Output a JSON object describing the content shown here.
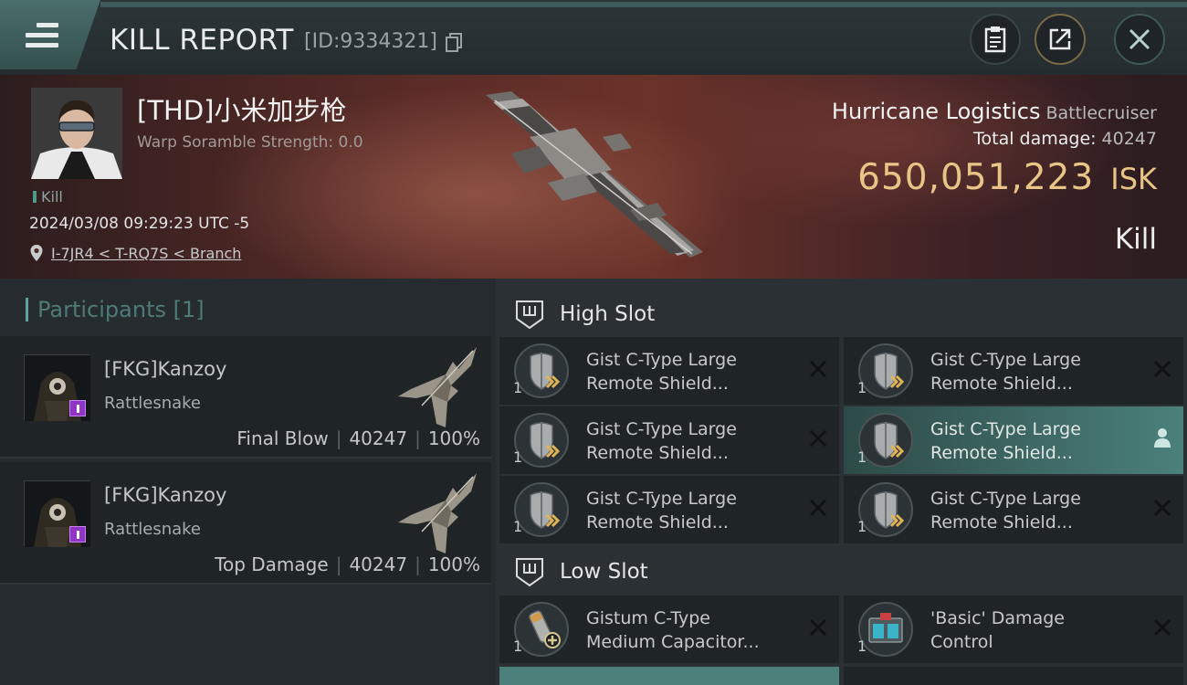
{
  "header": {
    "title": "KILL REPORT",
    "report_id": "[ID:9334321]",
    "menu_icon": "hamburger-menu-icon",
    "copy_icon": "copy-icon",
    "buttons": [
      {
        "name": "clipboard-button",
        "icon": "clipboard-icon"
      },
      {
        "name": "share-button",
        "icon": "share-icon"
      },
      {
        "name": "close-button",
        "icon": "close-icon"
      }
    ]
  },
  "victim": {
    "name": "[THD]小米加步枪",
    "scramble_label": "Warp Soramble Strength: 0.0",
    "kill_tag": "Kill",
    "timestamp": "2024/03/08 09:29:23 UTC -5",
    "location": "I-7JR4 < T-RQ7S < Branch"
  },
  "ship": {
    "name": "Hurricane Logistics",
    "class": "Battlecruiser",
    "total_damage_label": "Total damage:",
    "total_damage": "40247",
    "isk_value": "650,051,223",
    "isk_unit": "ISK",
    "result": "Kill"
  },
  "participants": {
    "title": "Participants [1]",
    "rows": [
      {
        "name": "[FKG]Kanzoy",
        "ship": "Rattlesnake",
        "role": "Final Blow",
        "damage": "40247",
        "percent": "100%"
      },
      {
        "name": "[FKG]Kanzoy",
        "ship": "Rattlesnake",
        "role": "Top Damage",
        "damage": "40247",
        "percent": "100%"
      }
    ]
  },
  "fitting": {
    "high_slot": {
      "title": "High Slot",
      "modules": [
        {
          "line1": "Gist C-Type Large",
          "line2": "Remote Shield...",
          "qty": "1",
          "action": "remove"
        },
        {
          "line1": "Gist C-Type Large",
          "line2": "Remote Shield...",
          "qty": "1",
          "action": "remove"
        },
        {
          "line1": "Gist C-Type Large",
          "line2": "Remote Shield...",
          "qty": "1",
          "action": "remove"
        },
        {
          "line1": "Gist C-Type Large",
          "line2": "Remote Shield...",
          "qty": "1",
          "action": "person"
        },
        {
          "line1": "Gist C-Type Large",
          "line2": "Remote Shield...",
          "qty": "1",
          "action": "remove"
        },
        {
          "line1": "Gist C-Type Large",
          "line2": "Remote Shield...",
          "qty": "1",
          "action": "remove"
        }
      ]
    },
    "low_slot": {
      "title": "Low Slot",
      "modules": [
        {
          "line1": "Gistum C-Type",
          "line2": "Medium Capacitor...",
          "qty": "1",
          "action": "remove"
        },
        {
          "line1": "'Basic' Damage",
          "line2": "Control",
          "qty": "1",
          "action": "remove"
        }
      ]
    }
  },
  "colors": {
    "accent_teal": "#5aa4a0",
    "isk_gold": "#e8c486",
    "badge_purple": "#9135c8",
    "active_module": "#4b807b"
  }
}
